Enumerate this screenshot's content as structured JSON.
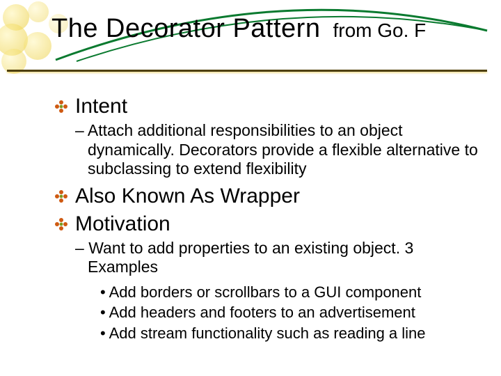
{
  "title": {
    "main": "The Decorator Pattern",
    "sub": "from Go. F"
  },
  "bullets": {
    "intent": {
      "heading": "Intent",
      "detail": "Attach additional responsibilities to an object dynamically. Decorators provide a flexible alternative to subclassing to extend flexibility"
    },
    "aka": {
      "heading": "Also Known As Wrapper"
    },
    "motivation": {
      "heading": "Motivation",
      "detail": "Want to add properties to an existing object. 3 Examples",
      "examples": [
        "Add borders or scrollbars to a GUI component",
        "Add headers and footers to an advertisement",
        "Add stream functionality such as reading a line"
      ]
    }
  },
  "colors": {
    "swoosh": "#0a7a2f",
    "floral_light": "#f6e37a",
    "floral_dark": "#e7c82e",
    "rule": "#4a3c0d"
  }
}
